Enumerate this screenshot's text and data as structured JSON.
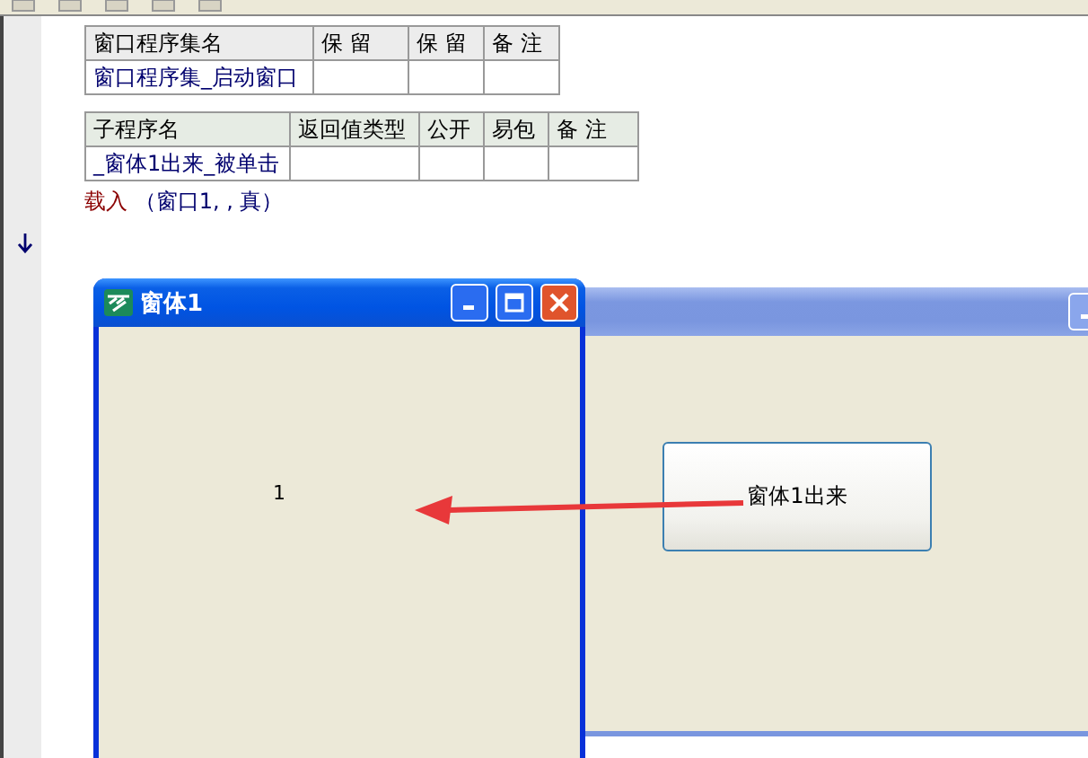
{
  "assembly_table": {
    "columns": [
      "窗口程序集名",
      "保 留",
      "保 留",
      "备 注"
    ],
    "rows": [
      {
        "name": "窗口程序集_启动窗口"
      }
    ]
  },
  "sub_table": {
    "columns": [
      "子程序名",
      "返回值类型",
      "公开",
      "易包",
      "备 注"
    ],
    "rows": [
      {
        "name": "_窗体1出来_被单击"
      }
    ]
  },
  "code_line": {
    "keyword": "载入",
    "args": "（窗口1, , 真）"
  },
  "back_window": {
    "active": false,
    "button": "窗体1出来"
  },
  "front_window": {
    "active": true,
    "title": "窗体1",
    "label": "1"
  }
}
